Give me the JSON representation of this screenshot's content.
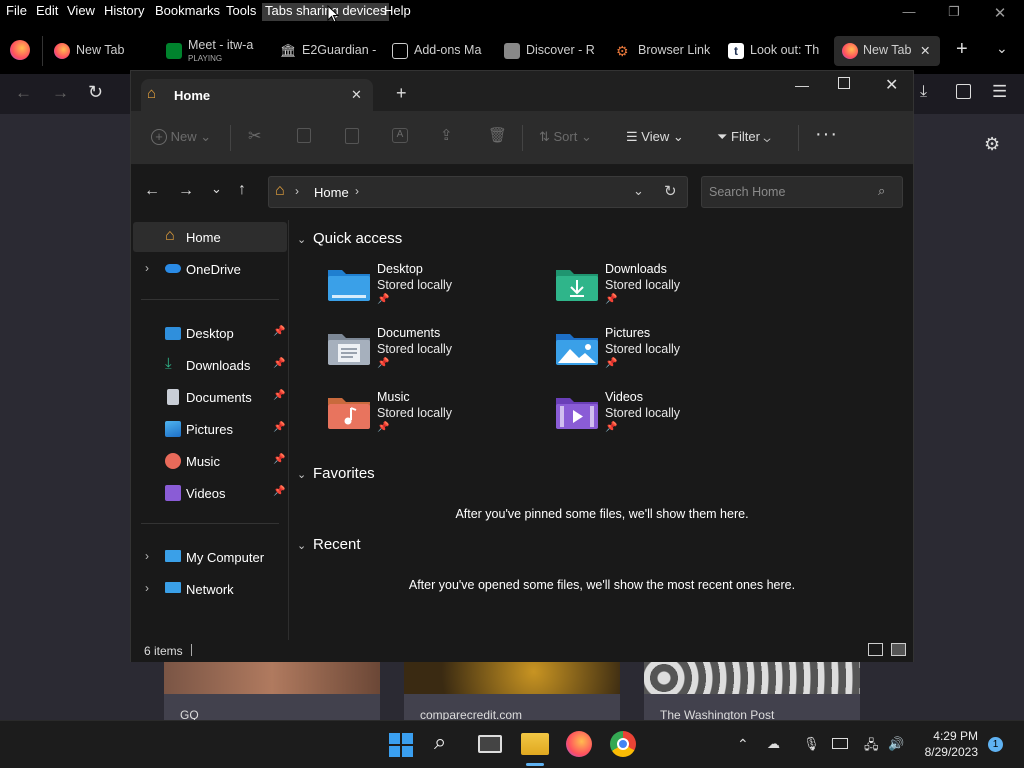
{
  "menubar": {
    "items": [
      "File",
      "Edit",
      "View",
      "History",
      "Bookmarks",
      "Tools",
      "Tabs sharing devices",
      "Help"
    ]
  },
  "browser_tabs": [
    {
      "label": "New Tab",
      "sub": ""
    },
    {
      "label": "Meet - itw-a",
      "sub": "PLAYING"
    },
    {
      "label": "E2Guardian -",
      "sub": ""
    },
    {
      "label": "Add-ons Ma",
      "sub": ""
    },
    {
      "label": "Discover - R",
      "sub": ""
    },
    {
      "label": "Browser Link",
      "sub": ""
    },
    {
      "label": "Look out: Th",
      "sub": ""
    },
    {
      "label": "New Tab",
      "sub": ""
    }
  ],
  "newtab_cards": [
    "GQ",
    "comparecredit.com",
    "The Washington Post"
  ],
  "explorer": {
    "tab_title": "Home",
    "commands": {
      "new": "New",
      "sort": "Sort",
      "view": "View",
      "filter": "Filter"
    },
    "address": {
      "crumb": "Home"
    },
    "search_placeholder": "Search Home",
    "sidebar": {
      "home": "Home",
      "onedrive": "OneDrive",
      "pinned": [
        "Desktop",
        "Downloads",
        "Documents",
        "Pictures",
        "Music",
        "Videos"
      ],
      "mycomputer": "My Computer",
      "network": "Network"
    },
    "quick_access": {
      "title": "Quick access",
      "items": [
        {
          "name": "Desktop",
          "status": "Stored locally"
        },
        {
          "name": "Downloads",
          "status": "Stored locally"
        },
        {
          "name": "Documents",
          "status": "Stored locally"
        },
        {
          "name": "Pictures",
          "status": "Stored locally"
        },
        {
          "name": "Music",
          "status": "Stored locally"
        },
        {
          "name": "Videos",
          "status": "Stored locally"
        }
      ]
    },
    "favorites": {
      "title": "Favorites",
      "empty": "After you've pinned some files, we'll show them here."
    },
    "recent": {
      "title": "Recent",
      "empty": "After you've opened some files, we'll show the most recent ones here."
    },
    "status": "6 items"
  },
  "taskbar": {
    "time": "4:29 PM",
    "date": "8/29/2023",
    "notifications": "1"
  },
  "colors": {
    "accent": "#0078d4",
    "folder_blue": "#3aa0e8",
    "downloads_green": "#2fb58a"
  }
}
